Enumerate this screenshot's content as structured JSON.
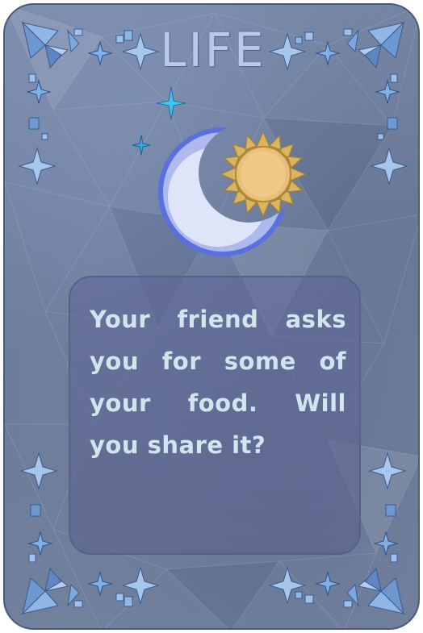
{
  "card": {
    "title": "LIFE",
    "question": "Your friend asks you for some of your food. Will you share it?"
  },
  "icons": {
    "emblem": "moon-and-sun-icon",
    "sparkle": "sparkle-icon",
    "corner_ornament": "star-ornament-icon"
  },
  "colors": {
    "card_background": "#6f7f9d",
    "title_text": "#b9c9ea",
    "question_text": "#cfe6ef",
    "moon": "#c9d4f2",
    "sun": "#e6c27a",
    "sparkle": "#3fb6e0"
  }
}
